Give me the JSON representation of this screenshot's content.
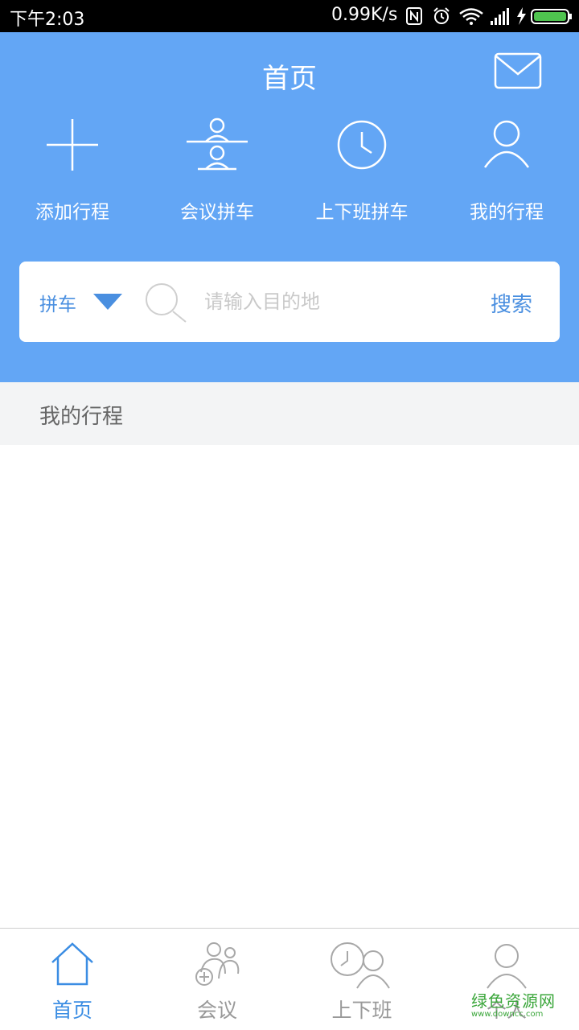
{
  "status_bar": {
    "time": "下午2:03",
    "network_speed": "0.99K/s",
    "icons": [
      "nfc-icon",
      "alarm-icon",
      "wifi-icon",
      "signal-icon",
      "charging-icon",
      "battery-icon"
    ]
  },
  "header": {
    "title": "首页",
    "mail_icon": "mail-icon",
    "background_color": "#63a6f5"
  },
  "shortcuts": [
    {
      "label": "添加行程",
      "icon": "plus-icon"
    },
    {
      "label": "会议拼车",
      "icon": "meeting-carpool-icon"
    },
    {
      "label": "上下班拼车",
      "icon": "clock-icon"
    },
    {
      "label": "我的行程",
      "icon": "person-icon"
    }
  ],
  "search": {
    "type_label": "拼车",
    "placeholder": "请输入目的地",
    "value": "",
    "button_label": "搜索",
    "accent_color": "#4a8fe0"
  },
  "section": {
    "title": "我的行程"
  },
  "bottom_nav": [
    {
      "label": "首页",
      "icon": "home-icon",
      "active": true
    },
    {
      "label": "会议",
      "icon": "meeting-icon",
      "active": false
    },
    {
      "label": "上下班",
      "icon": "commute-icon",
      "active": false
    },
    {
      "label": "个人",
      "icon": "profile-icon",
      "active": false
    }
  ],
  "watermark": {
    "text": "绿色资源网",
    "sub": "www.downcc.com"
  }
}
